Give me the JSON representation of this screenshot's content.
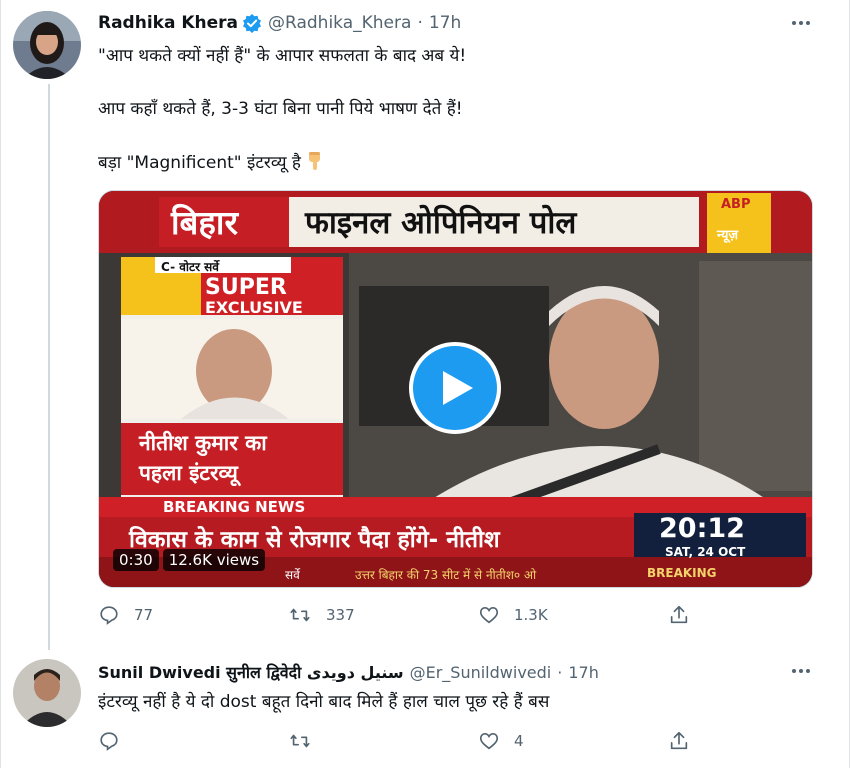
{
  "colors": {
    "accent": "#1d9bf0",
    "muted": "#536471",
    "text": "#0f1419"
  },
  "tweet1": {
    "name": "Radhika Khera",
    "handle": "@Radhika_Khera",
    "time": "17h",
    "line1": "\"आप थकते क्यों नहीं हैं\" के आपार सफलता के बाद अब ये!",
    "line2": "आप कहाँ थकते हैं, 3-3 घंटा बिना पानी पिये भाषण देते हैं!",
    "line3": "बड़ा \"Magnificent\" इंटरव्यू है",
    "emoji": "pointing-down-hand-icon",
    "video": {
      "banner_left": "बिहार",
      "banner_right": "फाइनल ओपिनियन पोल",
      "abp_top": "ABP",
      "abp_bottom": "न्यूज़",
      "cvoter": "C- वोटर सर्वे",
      "super": "SUPER",
      "exclusive": "EXCLUSIVE",
      "inset_line1": "नीतीश कुमार का",
      "inset_line2": "पहला इंटरव्यू",
      "breaking": "BREAKING NEWS",
      "headline": "विकास के काम से रोजगार पैदा होंगे- नीतीश",
      "clock_time": "20:12",
      "clock_date": "SAT, 24 OCT",
      "ticker_left": "सर्वे",
      "ticker": "उत्तर बिहार की 73 सीट में से नीतीश० ओ",
      "ticker_right": "BREAKING",
      "duration": "0:30",
      "views": "12.6K views"
    },
    "replies": "77",
    "retweets": "337",
    "likes": "1.3K"
  },
  "tweet2": {
    "name": "Sunil Dwivedi सुनील द्विवेदी سنیل دویدی",
    "handle": "@Er_Sunildwivedi",
    "time": "17h",
    "text": "इंटरव्यू नहीं है ये दो dost बहूत दिनो बाद मिले हैं हाल चाल पूछ रहे हैं बस",
    "replies": "",
    "retweets": "",
    "likes": "4"
  }
}
